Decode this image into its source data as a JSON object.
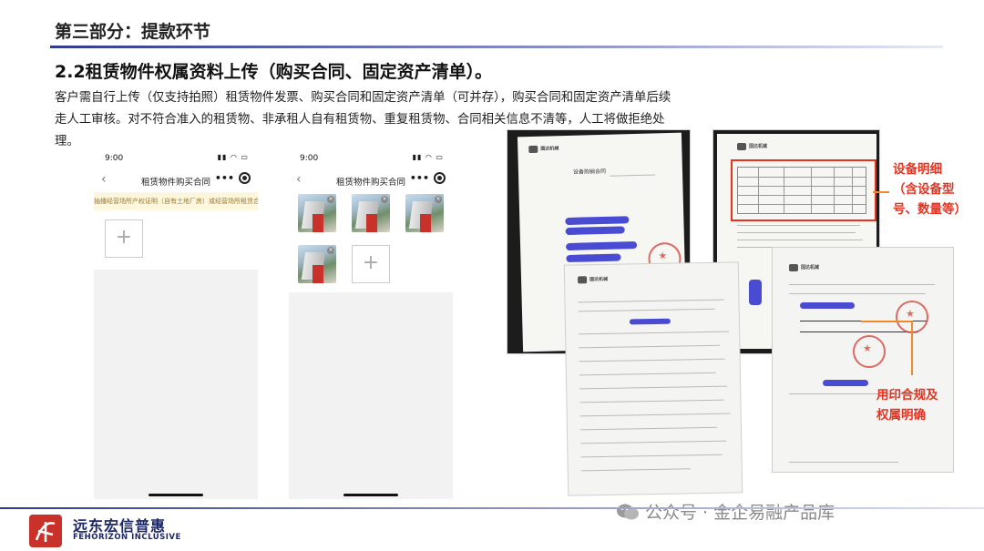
{
  "header": {
    "title": "第三部分：提款环节"
  },
  "section": {
    "title": "2.2租赁物件权属资料上传（购买合同、固定资产清单）。",
    "description": "客户需自行上传（仅支持拍照）租赁物件发票、购买合同和固定资产清单（可并存），购买合同和固定资产清单后续走人工审核。对不符合准入的租赁物、非承租人自有租赁物、重复租赁物、合同相关信息不清等，人工将做拒绝处理。"
  },
  "phone1": {
    "time": "9:00",
    "status_icons": "▮▮ ◠ ▭",
    "back_icon": "‹",
    "title": "租赁物件购买合同",
    "more": "•••",
    "hint": "抽播经营场所产权证明（自有土地厂房）或经营场所租赁合同",
    "add_icon": "+"
  },
  "phone2": {
    "time": "9:00",
    "status_icons": "▮▮ ◠ ▭",
    "back_icon": "‹",
    "title": "租赁物件购买合同",
    "more": "•••",
    "add_icon": "+",
    "photo_count": 4
  },
  "documents": {
    "doc1_heading": "设备购销合同",
    "logo_text": "国达机械"
  },
  "callouts": {
    "equipment": [
      "设备明细",
      "（含设备型",
      "号、数量等）"
    ],
    "seal": [
      "用印合规及",
      "权属明确"
    ]
  },
  "footer": {
    "company_cn": "远东宏信普惠",
    "company_en": "FEHORIZON INCLUSIVE",
    "watermark": "公众号 · 金企易融产品库"
  },
  "colors": {
    "accent_navy": "#2f3a8f",
    "callout_red": "#e8321f",
    "brand_red": "#c8322b",
    "redact_blue": "#3a3ccf"
  }
}
